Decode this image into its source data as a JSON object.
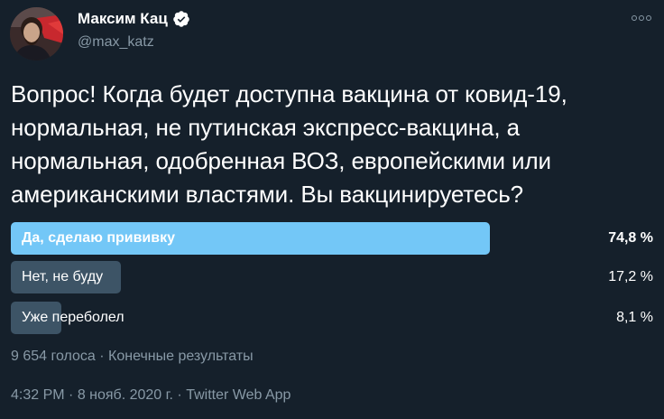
{
  "author": {
    "name": "Максим Кац",
    "handle": "@max_katz",
    "verified_icon": "verified-badge-icon",
    "avatar_icon": "avatar-photo"
  },
  "menu": {
    "icon": "more-options-icon"
  },
  "tweet_text": "Вопрос! Когда будет доступна вакцина от ковид-19, нормальная, не путинская экспресс-вакцина, а нормальная, одобренная ВОЗ, европейскими или американскими властями. Вы вакцинируетесь?",
  "poll": {
    "options": [
      {
        "label": "Да, сделаю прививку",
        "percent_text": "74,8 %",
        "percent": 74.8,
        "winner": true
      },
      {
        "label": "Нет, не буду",
        "percent_text": "17,2 %",
        "percent": 17.2,
        "winner": false
      },
      {
        "label": "Уже переболел",
        "percent_text": "8,1 %",
        "percent": 8.1,
        "winner": false
      }
    ],
    "votes_text": "9 654 голоса",
    "separator": " · ",
    "status_text": "Конечные результаты"
  },
  "meta": {
    "time": "4:32 PM",
    "date": "8 нояб. 2020 г.",
    "client": "Twitter Web App",
    "separator": " · "
  },
  "colors": {
    "background": "#15202b",
    "secondary_text": "#8899a6",
    "winner_bar": "#73c7f7",
    "other_bar": "#3d5466",
    "verified": "#ffffff"
  }
}
